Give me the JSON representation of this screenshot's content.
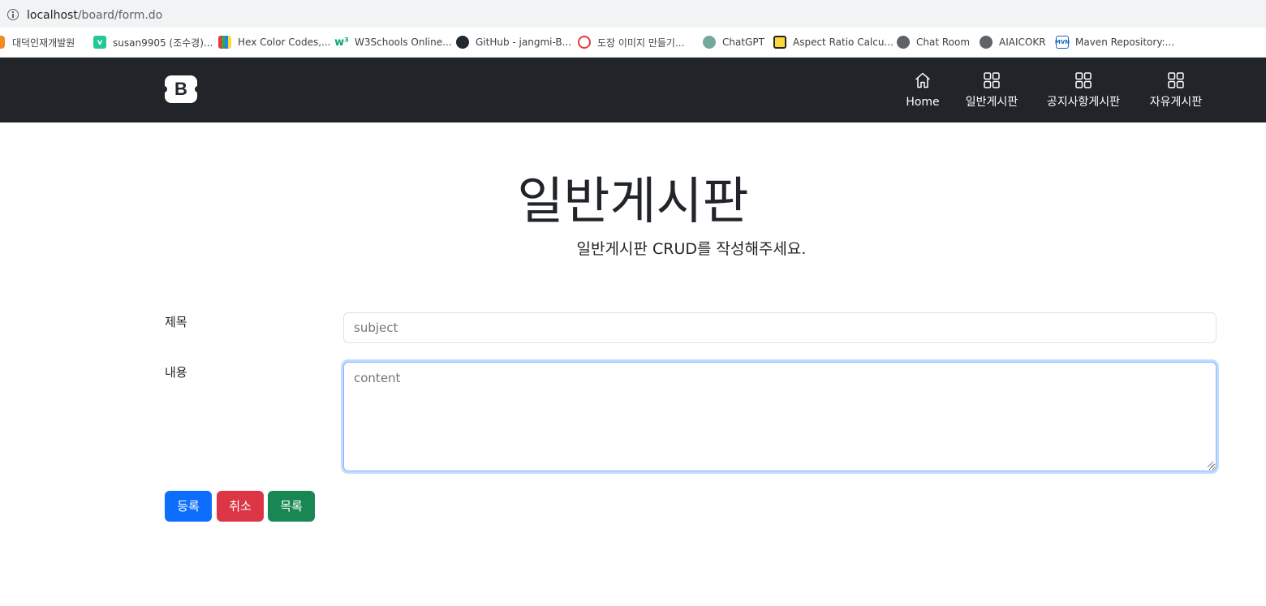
{
  "browser": {
    "url_host": "localhost",
    "url_path": "/board/form.do",
    "bookmarks": [
      {
        "label": "대덕인재개발원",
        "icon": "orange-bar-icon"
      },
      {
        "label": "susan9905 (조수경)...",
        "icon": "vimeo-icon"
      },
      {
        "label": "Hex Color Codes,...",
        "icon": "color-book-icon"
      },
      {
        "label": "W3Schools Online...",
        "icon": "w3schools-icon"
      },
      {
        "label": "GitHub - jangmi-B...",
        "icon": "github-icon"
      },
      {
        "label": "도장 이미지 만들기...",
        "icon": "stamp-icon"
      },
      {
        "label": "ChatGPT",
        "icon": "chatgpt-icon"
      },
      {
        "label": "Aspect Ratio Calcu...",
        "icon": "aspect-ratio-icon"
      },
      {
        "label": "Chat Room",
        "icon": "globe-icon"
      },
      {
        "label": "AIAICOKR",
        "icon": "globe-icon"
      },
      {
        "label": "Maven Repository:...",
        "icon": "maven-icon"
      }
    ]
  },
  "navbar": {
    "brand": "B",
    "items": [
      {
        "label": "Home",
        "icon": "home-icon"
      },
      {
        "label": "일반게시판",
        "icon": "grid-icon"
      },
      {
        "label": "공지사항게시판",
        "icon": "grid-icon"
      },
      {
        "label": "자유게시판",
        "icon": "grid-icon"
      }
    ]
  },
  "header": {
    "title": "일반게시판",
    "subtitle": "일반게시판 CRUD를 작성해주세요."
  },
  "form": {
    "subject_label": "제목",
    "subject_placeholder": "subject",
    "content_label": "내용",
    "content_placeholder": "content",
    "buttons": {
      "submit": "등록",
      "cancel": "취소",
      "list": "목록"
    }
  },
  "colors": {
    "navbar_bg": "#212529",
    "primary": "#0d6efd",
    "danger": "#dc3545",
    "success": "#198754"
  }
}
